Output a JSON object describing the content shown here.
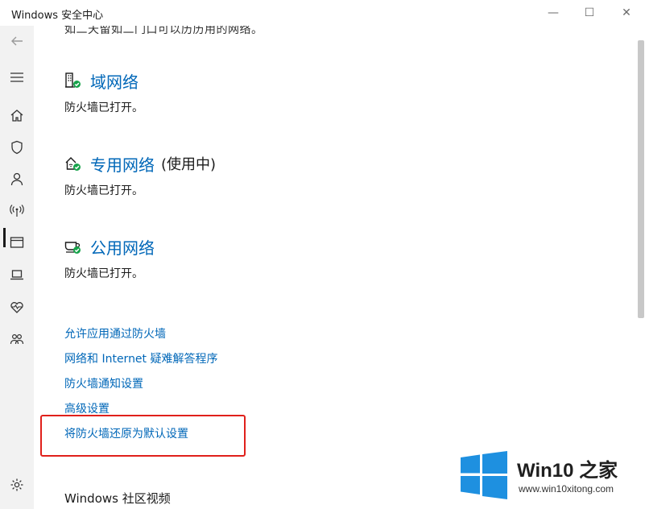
{
  "window": {
    "title": "Windows 安全中心",
    "min_glyph": "—",
    "max_glyph": "☐",
    "close_glyph": "✕"
  },
  "sidebar": {
    "items": [
      {
        "icon": "back-arrow-icon"
      },
      {
        "icon": "hamburger-menu-icon"
      },
      {
        "icon": "home-icon"
      },
      {
        "icon": "shield-icon"
      },
      {
        "icon": "person-icon"
      },
      {
        "icon": "wifi-antenna-icon",
        "active": true
      },
      {
        "icon": "browser-window-icon"
      },
      {
        "icon": "laptop-icon"
      },
      {
        "icon": "heart-pulse-icon"
      },
      {
        "icon": "family-icon"
      },
      {
        "icon": "gear-icon"
      }
    ]
  },
  "content": {
    "top_cut_text": "如二天留如二门口可以历历用的网络。",
    "networks": [
      {
        "title": "域网络",
        "suffix": "",
        "status": "防火墙已打开。",
        "icon": "domain-network-icon"
      },
      {
        "title": "专用网络",
        "suffix": "(使用中)",
        "status": "防火墙已打开。",
        "icon": "private-network-icon"
      },
      {
        "title": "公用网络",
        "suffix": "",
        "status": "防火墙已打开。",
        "icon": "public-network-icon"
      }
    ],
    "links": [
      "允许应用通过防火墙",
      "网络和 Internet 疑难解答程序",
      "防火墙通知设置",
      "高级设置",
      "将防火墙还原为默认设置"
    ],
    "bottom_heading": "Windows 社区视频",
    "bottom_cut_text": "ᴗᴗ"
  },
  "watermark": {
    "brand": "Win10 之家",
    "url": "www.win10xitong.com"
  },
  "colors": {
    "link_blue": "#0067b8",
    "status_green": "#16a34a",
    "highlight_red": "#e0201b",
    "win_logo_blue": "#1e90e0"
  }
}
